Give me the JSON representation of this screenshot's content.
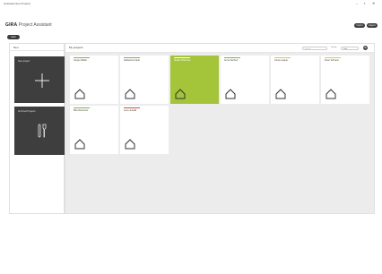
{
  "window": {
    "title": "[Unbekanntes Projekt]",
    "minimize": "–",
    "maximize": "▪",
    "close": "✕"
  },
  "header": {
    "brand": "GIRA",
    "app_name": "Project Assistant",
    "back_label": "back",
    "btn1": "Import",
    "btn2": "Export"
  },
  "left_panel": {
    "title": "Neu",
    "new_project": "New project",
    "archived_projects": "Archived Projects"
  },
  "main_panel": {
    "title": "My projects",
    "search_placeholder": "Search",
    "sort_label": "Sort by",
    "sort_value": "Date"
  },
  "projects": [
    {
      "name": "Jürgen Müller",
      "bar": "#7fb63a",
      "active": false
    },
    {
      "name": "Katharina Frank",
      "bar": "#7fb63a",
      "active": false
    },
    {
      "name": "Stefan Thümmel",
      "bar": "#7fb63a",
      "active": true
    },
    {
      "name": "Anna Teichert",
      "bar": "#7fb63a",
      "active": false
    },
    {
      "name": "Jonas Lagner",
      "bar": "#e8c43a",
      "active": false
    },
    {
      "name": "Peter Schreier",
      "bar": "#e8c43a",
      "active": false
    },
    {
      "name": "Mila Weschner",
      "bar": "#7fb63a",
      "active": false
    },
    {
      "name": "Lena Jendall",
      "bar": "#d64a3a",
      "active": false
    }
  ],
  "colors": {
    "accent": "#a4c43a",
    "dark_tile": "#3e3e3e"
  }
}
